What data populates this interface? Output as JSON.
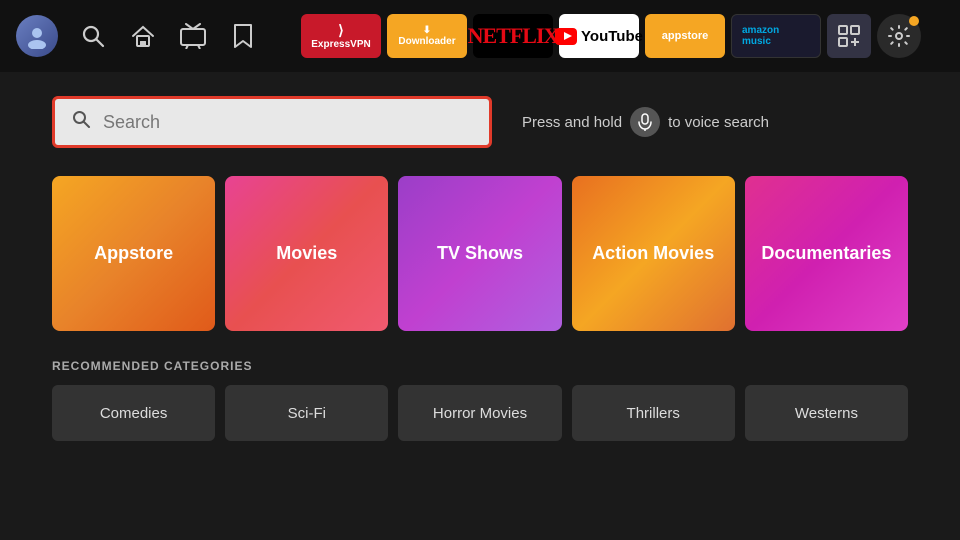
{
  "nav": {
    "apps": [
      {
        "id": "expressvpn",
        "label": "ExpressVPN",
        "bg": "#c8192a",
        "color": "#ffffff"
      },
      {
        "id": "downloader",
        "label": "Downloader",
        "bg": "#f5a623",
        "color": "#ffffff"
      },
      {
        "id": "netflix",
        "label": "NETFLIX",
        "bg": "#000000",
        "color": "#e50914"
      },
      {
        "id": "youtube",
        "label": "YouTube",
        "bg": "#ffffff",
        "color": "#000000"
      },
      {
        "id": "appstore",
        "label": "appstore",
        "bg": "#f5a623",
        "color": "#ffffff"
      },
      {
        "id": "amazon-music",
        "label": "amazon music",
        "bg": "#1a1a2e",
        "color": "#00a8e1"
      }
    ]
  },
  "search": {
    "placeholder": "Search",
    "voice_hint": "Press and hold",
    "voice_hint2": "to voice search"
  },
  "category_tiles": [
    {
      "id": "appstore",
      "label": "Appstore"
    },
    {
      "id": "movies",
      "label": "Movies"
    },
    {
      "id": "tvshows",
      "label": "TV Shows"
    },
    {
      "id": "action-movies",
      "label": "Action Movies"
    },
    {
      "id": "documentaries",
      "label": "Documentaries"
    }
  ],
  "recommended": {
    "section_label": "RECOMMENDED CATEGORIES",
    "items": [
      {
        "id": "comedies",
        "label": "Comedies"
      },
      {
        "id": "scifi",
        "label": "Sci-Fi"
      },
      {
        "id": "horror-movies",
        "label": "Horror Movies"
      },
      {
        "id": "thrillers",
        "label": "Thrillers"
      },
      {
        "id": "westerns",
        "label": "Westerns"
      }
    ]
  }
}
